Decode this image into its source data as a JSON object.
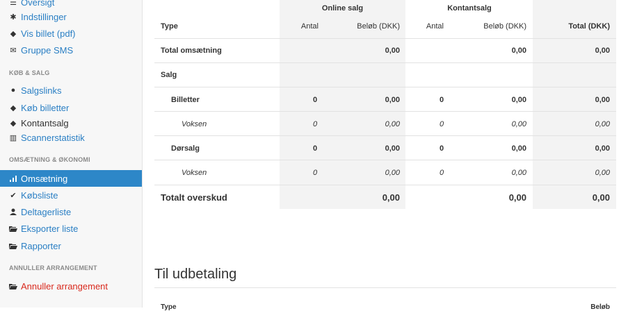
{
  "sidebar": {
    "oversigt": "Oversigt",
    "indstillinger": "Indstillinger",
    "vis_billet": "Vis billet (pdf)",
    "gruppe_sms": "Gruppe SMS",
    "section_kob_salg": "KØB & SALG",
    "salgslinks": "Salgslinks",
    "kob_billetter": "Køb billetter",
    "kontantsalg": "Kontantsalg",
    "scannerstatistik": "Scannerstatistik",
    "section_omsaetning": "OMSÆTNING & ØKONOMI",
    "omsaetning": "Omsætning",
    "kobsliste": "Købsliste",
    "deltagerliste": "Deltagerliste",
    "eksporter_liste": "Eksporter liste",
    "rapporter": "Rapporter",
    "section_annuller": "ANNULLER ARRANGEMENT",
    "annuller_arrangement": "Annuller arrangement"
  },
  "revenue_table": {
    "group_online": "Online salg",
    "group_kontant": "Kontantsalg",
    "col_type": "Type",
    "col_antal": "Antal",
    "col_belob": "Beløb (DKK)",
    "col_total": "Total (DKK)",
    "rows": [
      {
        "label": "Total omsætning",
        "online_antal": "",
        "online_belob": "0,00",
        "kontant_antal": "",
        "kontant_belob": "0,00",
        "total": "0,00"
      },
      {
        "label": "Salg",
        "online_antal": "",
        "online_belob": "",
        "kontant_antal": "",
        "kontant_belob": "",
        "total": ""
      },
      {
        "label": "Billetter",
        "online_antal": "0",
        "online_belob": "0,00",
        "kontant_antal": "0",
        "kontant_belob": "0,00",
        "total": "0,00"
      },
      {
        "label": "Voksen",
        "online_antal": "0",
        "online_belob": "0,00",
        "kontant_antal": "0",
        "kontant_belob": "0,00",
        "total": "0,00"
      },
      {
        "label": "Dørsalg",
        "online_antal": "0",
        "online_belob": "0,00",
        "kontant_antal": "0",
        "kontant_belob": "0,00",
        "total": "0,00"
      },
      {
        "label": "Voksen",
        "online_antal": "0",
        "online_belob": "0,00",
        "kontant_antal": "0",
        "kontant_belob": "0,00",
        "total": "0,00"
      },
      {
        "label": "Totalt overskud",
        "online_antal": "",
        "online_belob": "0,00",
        "kontant_antal": "",
        "kontant_belob": "0,00",
        "total": "0,00"
      }
    ]
  },
  "payout": {
    "title": "Til udbetaling",
    "col_type": "Type",
    "col_belob": "Beløb"
  }
}
